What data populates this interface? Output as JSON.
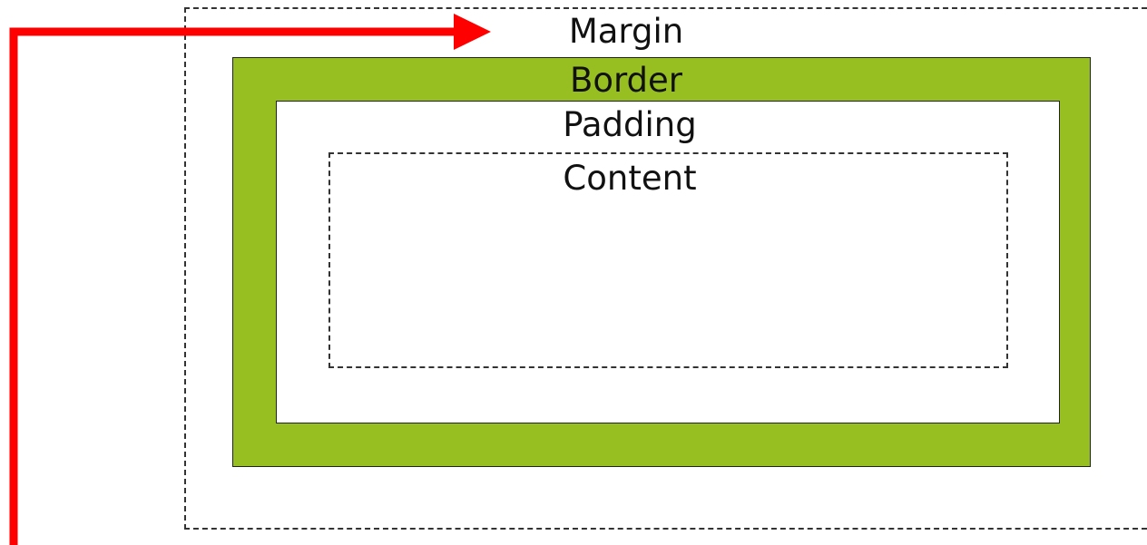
{
  "diagram": {
    "labels": {
      "margin": "Margin",
      "border": "Border",
      "padding": "Padding",
      "content": "Content"
    },
    "colors": {
      "border_fill": "#97BF22",
      "arrow": "#FF0000",
      "outline": "#222222",
      "dashed": "#333333",
      "background": "#FFFFFF"
    }
  }
}
